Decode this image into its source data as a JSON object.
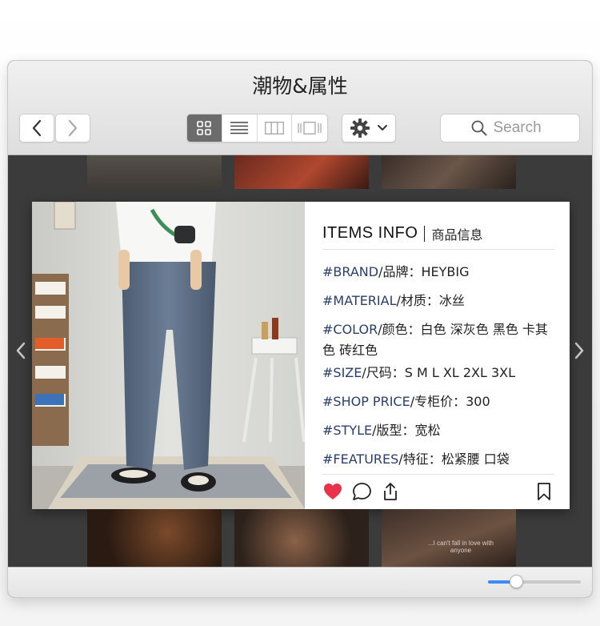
{
  "window": {
    "title": "潮物&属性"
  },
  "toolbar": {
    "nav_back_icon": "chevron-left-icon",
    "nav_forward_icon": "chevron-right-icon",
    "view_modes": [
      {
        "name": "grid",
        "icon": "grid-view-icon",
        "active": true
      },
      {
        "name": "list",
        "icon": "list-view-icon",
        "active": false
      },
      {
        "name": "columns",
        "icon": "column-view-icon",
        "active": false
      },
      {
        "name": "gallery",
        "icon": "coverflow-view-icon",
        "active": false
      }
    ],
    "action_icon": "gear-icon",
    "search": {
      "placeholder": "Search",
      "value": ""
    }
  },
  "preview_card": {
    "header_title": "ITEMS INFO",
    "header_subtitle": "商品信息",
    "attributes": [
      {
        "key": "#BRAND",
        "label": "/品牌：",
        "value": "HEYBIG"
      },
      {
        "key": "#MATERIAL",
        "label": "/材质：",
        "value": "冰丝"
      },
      {
        "key": "#COLOR",
        "label": "/颜色：",
        "value": "白色 深灰色 黑色 卡其色 砖红色"
      },
      {
        "key": "#SIZE",
        "label": "/尺码：",
        "value": "S M L XL 2XL 3XL"
      },
      {
        "key": "#SHOP PRICE",
        "label": "/专柜价：",
        "value": "300"
      },
      {
        "key": "#STYLE",
        "label": "/版型：",
        "value": "宽松"
      },
      {
        "key": "#FEATURES",
        "label": "/特征：",
        "value": "松紧腰 口袋"
      }
    ],
    "liked": true
  },
  "thumbnails": {
    "bottom_right_caption": "...I can't fall in love with anyone"
  },
  "zoom": {
    "value": 0.3
  },
  "colors": {
    "accent": "#3d8af7",
    "heart": "#e8334a",
    "attribute_key": "#2b3e6b"
  }
}
